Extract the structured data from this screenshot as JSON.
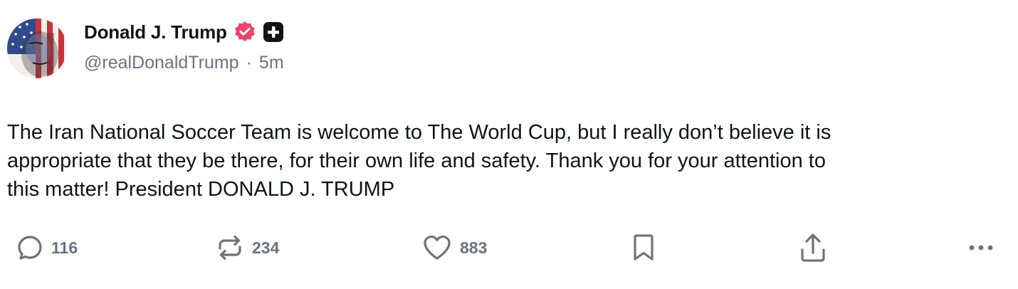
{
  "author": {
    "display_name": "Donald J. Trump",
    "handle": "@realDonaldTrump",
    "separator": "·",
    "time_ago": "5m",
    "avatar_icon": "flag-face-avatar",
    "verified_icon": "verified-badge-icon",
    "plus_icon": "plus-badge-icon",
    "verified_color": "#e8476a"
  },
  "post": {
    "text_line_1": "The Iran National Soccer Team is welcome to The World Cup, but I really don’t believe it is",
    "text_line_2": "appropriate that they be there, for their own life and safety. Thank you for your attention to",
    "text_line_3": "this matter! President DONALD J. TRUMP"
  },
  "actions": {
    "replies": "116",
    "retruths": "234",
    "likes": "883",
    "icons": [
      "reply-icon",
      "retruth-icon",
      "like-icon",
      "bookmark-icon",
      "share-icon",
      "more-icon"
    ]
  },
  "colors": {
    "text": "#0f1419",
    "muted": "#6b7280",
    "icon": "#71717a"
  }
}
